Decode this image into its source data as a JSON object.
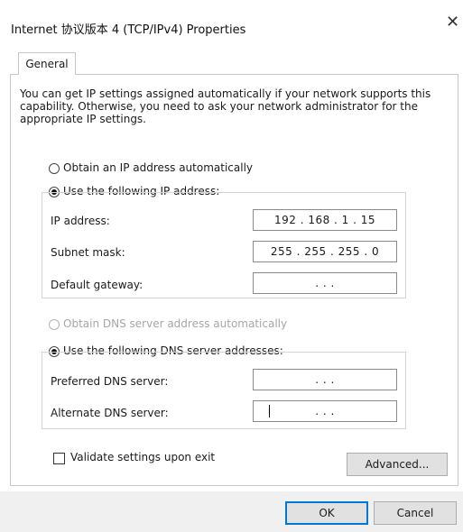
{
  "window": {
    "title": "Internet 协议版本 4 (TCP/IPv4) Properties",
    "close_glyph": "✕"
  },
  "tabs": [
    {
      "label": "General"
    }
  ],
  "description": "You can get IP settings assigned automatically if your network supports this capability. Otherwise, you need to ask your network administrator for the appropriate IP settings.",
  "ip_section": {
    "auto_label": "Obtain an IP address automatically",
    "manual_label": "Use the following IP address:",
    "selected": "manual",
    "fields": [
      {
        "label": "IP address:",
        "value": "192 . 168 .  1  . 15"
      },
      {
        "label": "Subnet mask:",
        "value": "255 . 255 . 255 .  0"
      },
      {
        "label": "Default gateway:",
        "value": ".        .        ."
      }
    ]
  },
  "dns_section": {
    "auto_label": "Obtain DNS server address automatically",
    "manual_label": "Use the following DNS server addresses:",
    "selected": "manual",
    "auto_disabled": true,
    "fields": [
      {
        "label": "Preferred DNS server:",
        "value": ".        .        ."
      },
      {
        "label": "Alternate DNS server:",
        "value": ".        .        ."
      }
    ]
  },
  "validate": {
    "label": "Validate settings upon exit",
    "checked": false
  },
  "buttons": {
    "advanced": "Advanced...",
    "ok": "OK",
    "cancel": "Cancel"
  },
  "icons": {
    "radio_checked": "radio-selected-icon",
    "close": "close-icon"
  }
}
